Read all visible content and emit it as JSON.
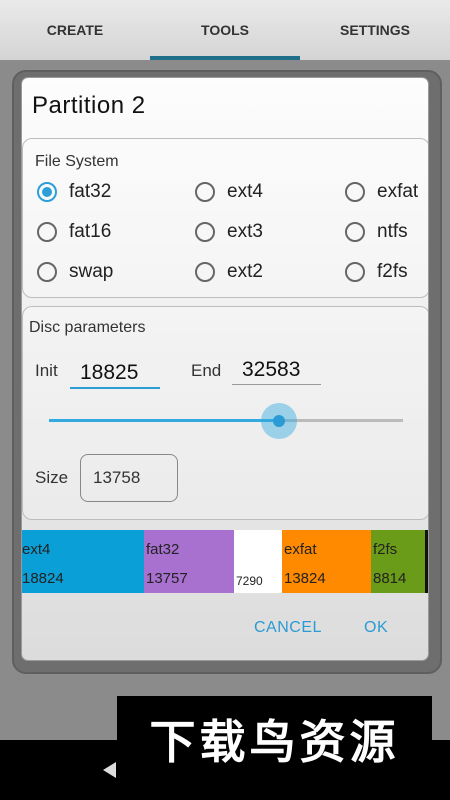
{
  "tabs": [
    {
      "label": "CREATE"
    },
    {
      "label": "TOOLS"
    },
    {
      "label": "SETTINGS"
    }
  ],
  "dialog": {
    "title": "Partition  2",
    "file_system": {
      "label": "File System",
      "options": [
        {
          "label": "fat32",
          "checked": true
        },
        {
          "label": "ext4",
          "checked": false
        },
        {
          "label": "exfat",
          "checked": false
        },
        {
          "label": "fat16",
          "checked": false
        },
        {
          "label": "ext3",
          "checked": false
        },
        {
          "label": "ntfs",
          "checked": false
        },
        {
          "label": "swap",
          "checked": false
        },
        {
          "label": "ext2",
          "checked": false
        },
        {
          "label": "f2fs",
          "checked": false
        }
      ]
    },
    "disc": {
      "label": "Disc parameters",
      "init_label": "Init",
      "init_value": "18825",
      "end_label": "End",
      "end_value": "32583",
      "slider_fraction": 0.65,
      "size_label": "Size",
      "size_value": "13758"
    },
    "partitions": [
      {
        "name": "ext4",
        "size": "18824",
        "color": "#0a9fd6"
      },
      {
        "name": "fat32",
        "size": "13757",
        "color": "#a870cf"
      },
      {
        "name": "",
        "size": "7290",
        "color": "#ffffff"
      },
      {
        "name": "exfat",
        "size": "13824",
        "color": "#ff8a00"
      },
      {
        "name": "f2fs",
        "size": "8814",
        "color": "#6a9c19"
      }
    ],
    "cancel_label": "CANCEL",
    "ok_label": "OK"
  },
  "watermark": "下载鸟资源",
  "accent": "#2c9fd6"
}
